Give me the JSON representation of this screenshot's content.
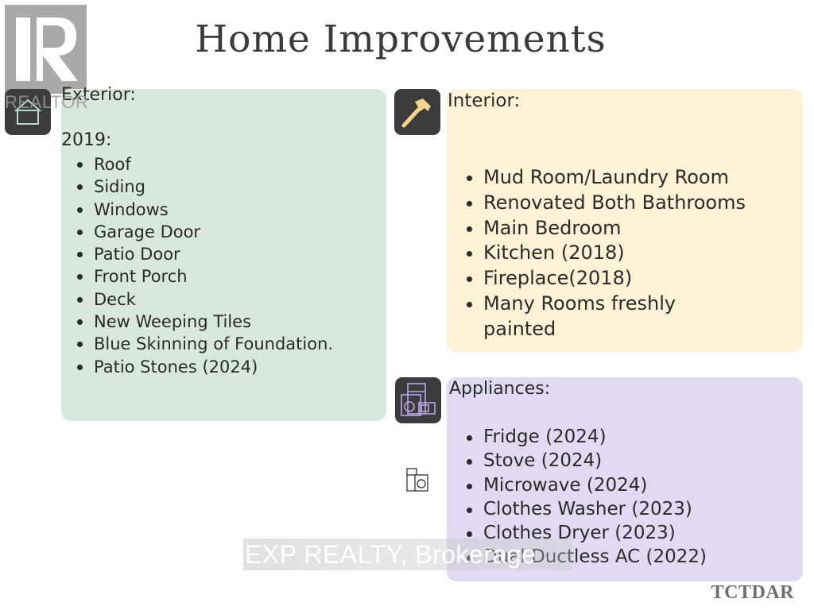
{
  "title": "Home Improvements",
  "logo": {
    "name": "REALTOR",
    "icon": "realtor-r-icon"
  },
  "exterior": {
    "icon": "house-icon",
    "heading": "Exterior:",
    "year_label": "2019:",
    "items": [
      "Roof",
      "Siding",
      "Windows",
      "Garage Door",
      "Patio Door",
      "Front Porch",
      "Deck",
      "New Weeping Tiles",
      "Blue Skinning of Foundation.",
      "Patio Stones (2024)"
    ]
  },
  "interior": {
    "icon": "hammer-icon",
    "heading": "Interior:",
    "items": [
      "Mud Room/Laundry Room",
      "Renovated Both Bathrooms",
      "Main Bedroom",
      "Kitchen (2018)",
      "Fireplace(2018)",
      "Many Rooms freshly painted"
    ]
  },
  "appliances": {
    "icon": "appliances-icon",
    "heading": "Appliances:",
    "items": [
      "Fridge (2024)",
      "Stove (2024)",
      "Microwave (2024)",
      "Clothes Washer (2023)",
      "Clothes Dryer (2023)",
      "Dual Ductless AC (2022)"
    ]
  },
  "watermark": "EXP REALTY, Brokerage",
  "brand": "TCTDAR",
  "colors": {
    "exterior_bg": "#d9e8df",
    "interior_bg": "#fdf2d5",
    "appliances_bg": "#e1daf2",
    "icon_tile": "#3d3c3c"
  }
}
